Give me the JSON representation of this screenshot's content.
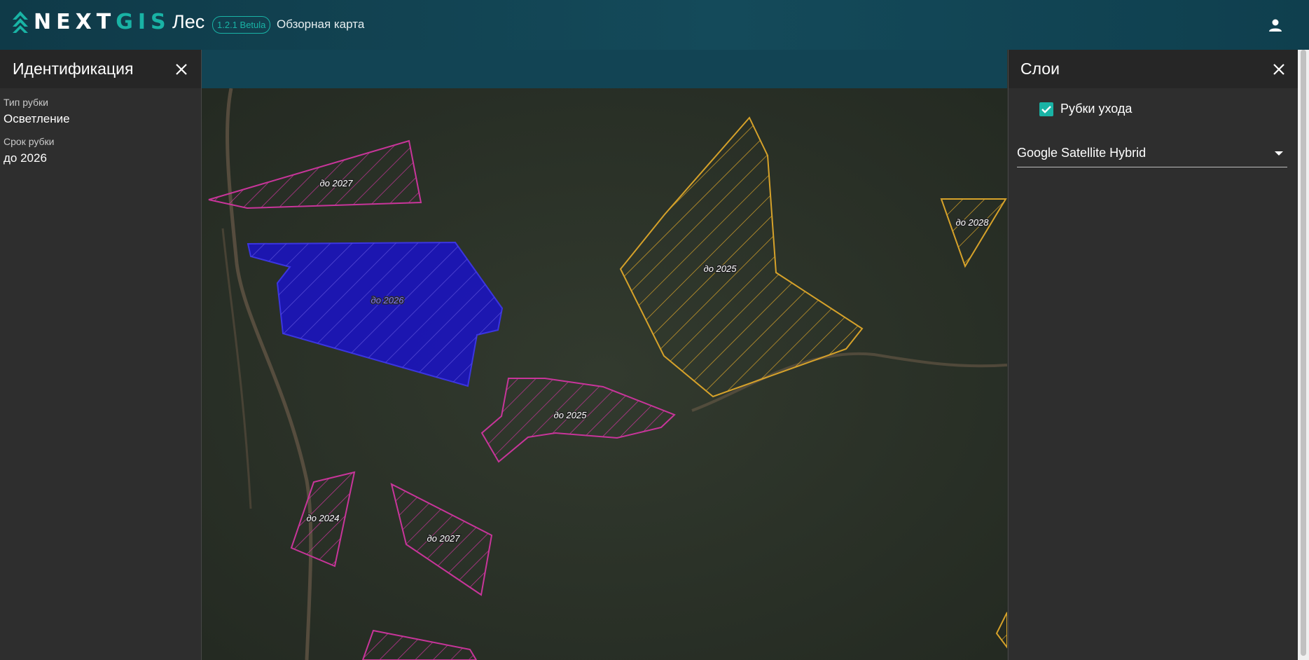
{
  "header": {
    "logo_prefix": "N",
    "logo_main": "EXT",
    "logo_accent": "GIS",
    "app_name": "Лес",
    "version": "1.2.1 Betula",
    "map_title": "Обзорная карта",
    "user_icon": "user-icon"
  },
  "identify_panel": {
    "title": "Идентификация",
    "fields": [
      {
        "label": "Тип рубки",
        "value": "Осветление"
      },
      {
        "label": "Срок рубки",
        "value": "до 2026"
      }
    ]
  },
  "layers_panel": {
    "title": "Слои",
    "layers": [
      {
        "label": "Рубки ухода",
        "checked": true
      }
    ],
    "basemap": "Google Satellite Hybrid"
  },
  "map": {
    "colors": {
      "pink": "#c8359a",
      "orange": "#d6a22a",
      "selected": "#1a12c8"
    },
    "polygon_labels": [
      "до 2027",
      "до 2026",
      "до 2025",
      "до 2028",
      "до 2025",
      "до 2024",
      "до 2027"
    ]
  }
}
